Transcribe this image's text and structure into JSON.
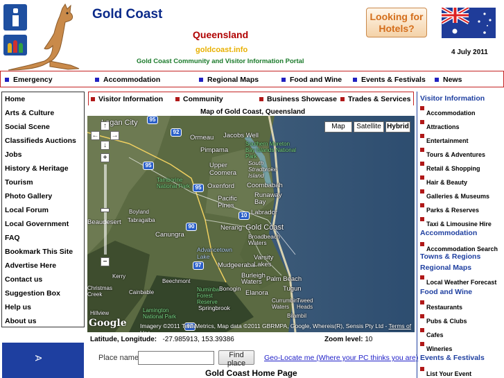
{
  "header": {
    "title": "Gold Coast",
    "state": "Queensland",
    "domain": "goldcoast.info",
    "tagline": "Gold Coast Community and Visitor Information Portal",
    "hotels_button": "Looking for Hotels?",
    "date": "4 July 2011"
  },
  "topnav": [
    "Emergency",
    "Accommodation",
    "Regional Maps",
    "Food and Wine",
    "Events & Festivals",
    "News"
  ],
  "leftnav": [
    "Home",
    "Arts & Culture",
    "Social Scene",
    "Classifieds Auctions",
    "Jobs",
    "History & Heritage",
    "Tourism",
    "Photo Gallery",
    "Local Forum",
    "Local Government",
    "FAQ",
    "Bookmark This Site",
    "Advertise Here",
    "Contact us",
    "Suggestion Box",
    "Help us",
    "About us"
  ],
  "promo_text": "A",
  "subnav": [
    "Visitor Information",
    "Community",
    "Business Showcase",
    "Trades & Services"
  ],
  "map": {
    "title": "Map of Gold Coast, Queensland",
    "types": [
      "Map",
      "Satellite",
      "Hybrid"
    ],
    "selected_type": "Hybrid",
    "zoom_controls": [
      "+",
      "−"
    ],
    "pan_controls": [
      "↑",
      "←",
      "→",
      "↓"
    ],
    "labels": [
      "Logan City",
      "Ormeau",
      "Jacobs Well",
      "Pimpama",
      "Southern Moreton Bay Islands National Park",
      "Upper Coomera",
      "South Stradbroke Island",
      "Tamborine National Park",
      "Oxenford",
      "Coombabah",
      "Pacific Pines",
      "Runaway Bay",
      "Labrador",
      "Beaudesert",
      "Boyland",
      "Tabragalba",
      "Canungra",
      "Nerang",
      "Gold Coast",
      "Broadbeach Waters",
      "Advancetown Lake",
      "Varsity Lakes",
      "Mudgeeraba",
      "Kerry",
      "Beechmont",
      "Burleigh Waters",
      "Palm Beach",
      "Numinbah Forest Reserve",
      "Bonogin",
      "Elanora",
      "Tugun",
      "Christmas Creek",
      "Cainbable",
      "Currumbin Waters",
      "Tweed Heads",
      "Springbrook",
      "Lamington National Park",
      "Hillview",
      "Bilambil"
    ],
    "highways": [
      "95",
      "92",
      "95",
      "95",
      "10",
      "90",
      "97",
      "97",
      "95"
    ],
    "attribution": "Imagery ©2011 TerraMetrics, Map data ©2011 GBRMPA, Google, Whereis(R), Sensis Pty Ltd -",
    "terms": "Terms of Use",
    "logo": "Google"
  },
  "coords": {
    "label": "Latitude, Longitude:",
    "value": "-27.985913, 153.39386",
    "zoom_label": "Zoom level:",
    "zoom_value": "10"
  },
  "search": {
    "label": "Place name:",
    "value": "",
    "button": "Find place",
    "geolocate": "Geo-Locate me (Where your PC thinks you are)"
  },
  "home_heading": "Gold Coast Home Page",
  "rightcol": [
    {
      "type": "head",
      "text": "Visitor Information"
    },
    {
      "type": "item",
      "text": "Accommodation"
    },
    {
      "type": "item",
      "text": "Attractions"
    },
    {
      "type": "item",
      "text": "Entertainment"
    },
    {
      "type": "item",
      "text": "Tours & Adventures"
    },
    {
      "type": "item",
      "text": "Retail & Shopping"
    },
    {
      "type": "item",
      "text": "Hair & Beauty"
    },
    {
      "type": "item",
      "text": "Galleries & Museums"
    },
    {
      "type": "item",
      "text": "Parks & Reserves"
    },
    {
      "type": "item",
      "text": "Taxi & Limousine Hire"
    },
    {
      "type": "head",
      "text": "Accommodation"
    },
    {
      "type": "item",
      "text": "Accommodation Search"
    },
    {
      "type": "head",
      "text": "Towns & Regions"
    },
    {
      "type": "head",
      "text": "Regional Maps"
    },
    {
      "type": "item",
      "text": "Local Weather Forecast"
    },
    {
      "type": "head",
      "text": "Food and Wine"
    },
    {
      "type": "item",
      "text": "Restaurants"
    },
    {
      "type": "item",
      "text": "Pubs & Clubs"
    },
    {
      "type": "item",
      "text": "Cafes"
    },
    {
      "type": "item",
      "text": "Wineries"
    },
    {
      "type": "head",
      "text": "Events & Festivals"
    },
    {
      "type": "item",
      "text": "List Your Event"
    }
  ],
  "colors": {
    "brand_blue": "#0b2a8a",
    "accent_red": "#b00000",
    "nav_border": "#c42222",
    "domain_gold": "#e8b000",
    "tagline_green": "#1a7a2a"
  },
  "icons": [
    "info-icon",
    "people-icon",
    "kangaroo-logo",
    "australian-flag"
  ]
}
